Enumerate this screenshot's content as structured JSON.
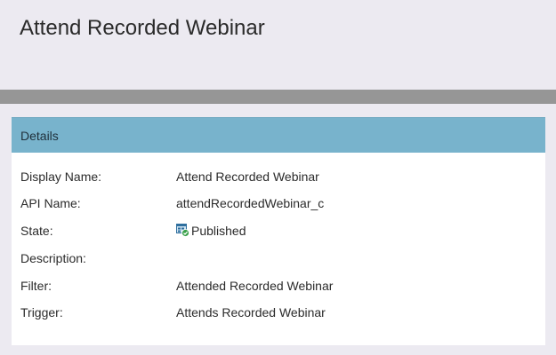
{
  "page": {
    "title": "Attend Recorded Webinar"
  },
  "details": {
    "header": "Details",
    "rows": [
      {
        "label": "Display Name:",
        "value": "Attend Recorded Webinar"
      },
      {
        "label": "API Name:",
        "value": "attendRecordedWebinar_c"
      },
      {
        "label": "State:",
        "value": "Published",
        "icon": "published-status-icon"
      },
      {
        "label": "Description:",
        "value": ""
      },
      {
        "label": "Filter:",
        "value": "Attended Recorded Webinar"
      },
      {
        "label": "Trigger:",
        "value": "Attends Recorded Webinar"
      }
    ]
  },
  "colors": {
    "background": "#eceaf1",
    "divider": "#969696",
    "panel_header": "#78b3cc",
    "panel_body": "#ffffff"
  }
}
